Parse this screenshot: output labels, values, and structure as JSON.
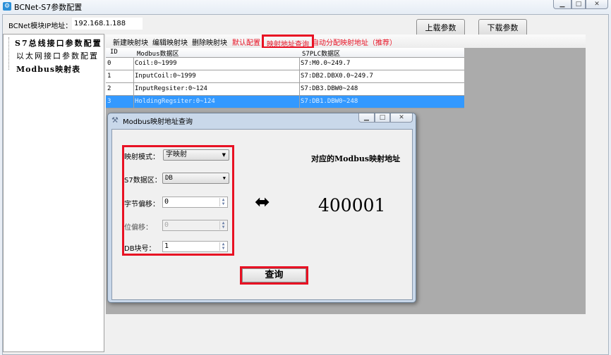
{
  "window": {
    "title": "BCNet-S7参数配置",
    "minimize": "▁",
    "maximize": "□",
    "close": "✕"
  },
  "ip": {
    "label": "BCNet模块IP地址：",
    "value": "192.168.1.188"
  },
  "buttons": {
    "upload": "上载参数",
    "download": "下载参数"
  },
  "tree": [
    "S7总线接口参数配置",
    "以太网接口参数配置",
    "Modbus映射表"
  ],
  "toolbar": [
    "新建映射块",
    "编辑映射块",
    "删除映射块",
    "默认配置",
    "映射地址查询",
    "自动分配映射地址（推荐）"
  ],
  "colors": {
    "accent_red": "#e81123",
    "selection": "#3399ff"
  },
  "table": {
    "headers": [
      "ID",
      "Modbus数据区",
      "S7PLC数据区"
    ],
    "rows": [
      [
        "0",
        "Coil:0~1999",
        "S7:M0.0~249.7"
      ],
      [
        "1",
        "InputCoil:0~1999",
        "S7:DB2.DBX0.0~249.7"
      ],
      [
        "2",
        "InputRegsiter:0~124",
        "S7:DB3.DBW0~248"
      ],
      [
        "3",
        "HoldingRegsiter:0~124",
        "S7:DB1.DBW0~248"
      ]
    ],
    "selected_row": 3
  },
  "dialog": {
    "title": "Modbus映射地址查询",
    "fields": {
      "mode_label": "映射模式：",
      "mode_value": "字映射",
      "area_label": "S7数据区：",
      "area_value": "DB",
      "byte_label": "字节偏移：",
      "byte_value": "0",
      "bit_label": "位偏移：",
      "bit_value": "0",
      "db_label": "DB块号：",
      "db_value": "1"
    },
    "result_label": "对应的Modbus映射地址",
    "result_value": "400001",
    "query_button": "查询"
  }
}
